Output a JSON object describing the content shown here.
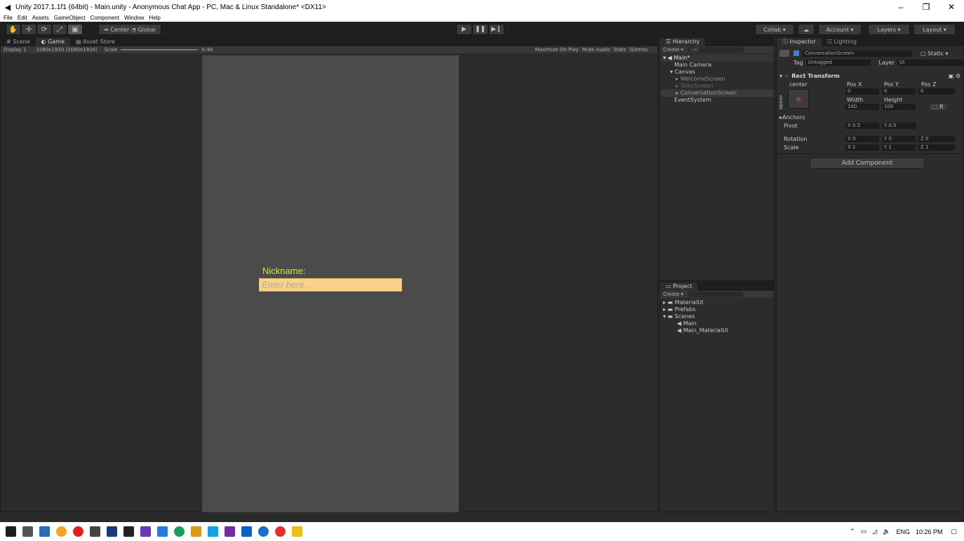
{
  "window": {
    "title": "Unity 2017.1.1f1 (64bit) - Main.unity - Anonymous Chat App - PC, Mac & Linux Standalone* <DX11>",
    "minimize": "–",
    "maximize": "❐",
    "close": "✕"
  },
  "menu": [
    "File",
    "Edit",
    "Assets",
    "GameObject",
    "Component",
    "Window",
    "Help"
  ],
  "toolbar": {
    "pivot": "Center",
    "space": "Global",
    "collab": "Collab ▾",
    "account": "Account ▾",
    "layers": "Layers ▾",
    "layout": "Layout ▾"
  },
  "game_tabs": [
    "Scene",
    "Game",
    "Asset Store"
  ],
  "game_bar": {
    "display": "Display 1",
    "resolution": "1080x1920 (1080x1920)",
    "scale_label": "Scale",
    "scale_value": "0.48",
    "maximize": "Maximize On Play",
    "mute": "Mute Audio",
    "stats": "Stats",
    "gizmos": "Gizmos"
  },
  "game_view": {
    "nickname_label": "Nickname:",
    "nickname_placeholder": "Enter here.."
  },
  "hierarchy": {
    "tab": "Hierarchy",
    "create": "Create ▾",
    "search": "All",
    "scene": "Main*",
    "items": [
      "Main Camera",
      "Canvas",
      "WelcomeScreen",
      "TalksScreen",
      "ConversationScreen",
      "EventSystem"
    ]
  },
  "project": {
    "tab": "Project",
    "create": "Create ▾",
    "folders": [
      "MaterialUI",
      "Prefabs",
      "Scenes"
    ],
    "scenes": [
      "Main",
      "Main_MaterialUI"
    ]
  },
  "inspector": {
    "tabs": [
      "Inspector",
      "Lighting"
    ],
    "object_name": "ConversationScreen",
    "static": "Static",
    "tag_label": "Tag",
    "tag_value": "Untagged",
    "layer_label": "Layer",
    "layer_value": "UI",
    "component": "Rect Transform",
    "anchor_h": "center",
    "anchor_v": "middle",
    "pos_x_label": "Pos X",
    "pos_y_label": "Pos Y",
    "pos_z_label": "Pos Z",
    "pos_x": "0",
    "pos_y": "0",
    "pos_z": "0",
    "width_label": "Width",
    "height_label": "Height",
    "width": "100",
    "height": "100",
    "r_btn": "R",
    "anchors": "Anchors",
    "pivot_label": "Pivot",
    "pivot_x": "X 0.5",
    "pivot_y": "Y 0.5",
    "rotation_label": "Rotation",
    "rot_x": "X 0",
    "rot_y": "Y 0",
    "rot_z": "Z 0",
    "scale_label": "Scale",
    "scale_x": "X 1",
    "scale_y": "Y 1",
    "scale_z": "Z 1",
    "add_component": "Add Component"
  },
  "taskbar": {
    "lang": "ENG",
    "time": "10:26 PM"
  }
}
